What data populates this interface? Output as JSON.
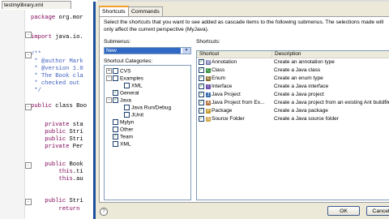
{
  "editor": {
    "tab_label": "testmylibrary.xml",
    "lines": [
      {
        "text": "package org.mor",
        "type": "code"
      },
      {
        "text": "import java.io.",
        "type": "code"
      },
      {
        "text": "/**",
        "type": "comment"
      },
      {
        "text": " * @author Mark",
        "type": "comment"
      },
      {
        "text": " * @version 1.0",
        "type": "comment"
      },
      {
        "text": " * The Book cla",
        "type": "comment"
      },
      {
        "text": " * checked out",
        "type": "comment"
      },
      {
        "text": " */",
        "type": "comment"
      },
      {
        "text": "public class Boo",
        "type": "code"
      },
      {
        "text": "    private sta",
        "type": "code"
      },
      {
        "text": "    public Stri",
        "type": "code"
      },
      {
        "text": "    public Stri",
        "type": "code"
      },
      {
        "text": "    private Per",
        "type": "code"
      },
      {
        "text": "    public Book",
        "type": "code"
      },
      {
        "text": "        this.ti",
        "type": "code"
      },
      {
        "text": "        this.au",
        "type": "code"
      },
      {
        "text": "    public Stri",
        "type": "code"
      },
      {
        "text": "        return",
        "type": "code"
      }
    ]
  },
  "dialog": {
    "tabs": [
      "Shortcuts",
      "Commands"
    ],
    "description": "Select the shortcuts that you want to see added as cascade items to the following submenus.  The selections made will only affect the current perspective (MyJava).",
    "submenus_label": "Submenus:",
    "submenus_value": "New",
    "categories_label": "Shortcut Categories:",
    "shortcuts_label": "Shortcuts:",
    "categories": [
      {
        "label": "CVS",
        "checked": false,
        "expander": "+",
        "indent": 0
      },
      {
        "label": "Examples",
        "checked": false,
        "expander": "-",
        "indent": 0
      },
      {
        "label": "XML",
        "checked": false,
        "expander": "",
        "indent": 1
      },
      {
        "label": "General",
        "checked": true,
        "expander": "",
        "indent": 0
      },
      {
        "label": "Java",
        "checked": true,
        "expander": "-",
        "indent": 0
      },
      {
        "label": "Java Run/Debug",
        "checked": false,
        "expander": "",
        "indent": 1
      },
      {
        "label": "JUnit",
        "checked": false,
        "expander": "",
        "indent": 1
      },
      {
        "label": "Mylyn",
        "checked": false,
        "expander": "",
        "indent": 0
      },
      {
        "label": "Other",
        "checked": false,
        "expander": "",
        "indent": 0
      },
      {
        "label": "Team",
        "checked": true,
        "expander": "",
        "indent": 0
      },
      {
        "label": "XML",
        "checked": false,
        "expander": "",
        "indent": 0
      }
    ],
    "columns": [
      "Shortcut",
      "Description"
    ],
    "shortcuts": [
      {
        "name": "Annotation",
        "description": "Create an annotation type",
        "checked": true,
        "icon": "annotation-icon",
        "color": "#6a6aa8",
        "glyph": "@"
      },
      {
        "name": "Class",
        "description": "Create a Java class",
        "checked": true,
        "icon": "class-icon",
        "color": "#2e8b3a",
        "glyph": "C"
      },
      {
        "name": "Enum",
        "description": "Create an enum type",
        "checked": true,
        "icon": "enum-icon",
        "color": "#8a6d2b",
        "glyph": "E"
      },
      {
        "name": "Interface",
        "description": "Create a Java interface",
        "checked": true,
        "icon": "interface-icon",
        "color": "#6b4fa8",
        "glyph": "I"
      },
      {
        "name": "Java Project",
        "description": "Create a Java project",
        "checked": true,
        "icon": "java-project-icon",
        "color": "#3a6fb0",
        "glyph": "J"
      },
      {
        "name": "Java Project from Ex...",
        "description": "Create a Java project from an existing Ant buildfile",
        "checked": true,
        "icon": "ant-project-icon",
        "color": "#b0703a",
        "glyph": "A"
      },
      {
        "name": "Package",
        "description": "Create a Java package",
        "checked": true,
        "icon": "package-icon",
        "color": "#c49a2b",
        "glyph": "P"
      },
      {
        "name": "Source Folder",
        "description": "Create a Java source folder",
        "checked": true,
        "icon": "source-folder-icon",
        "color": "#d2a64a",
        "glyph": "S"
      }
    ],
    "ok_label": "OK",
    "cancel_label": "Cancel"
  }
}
